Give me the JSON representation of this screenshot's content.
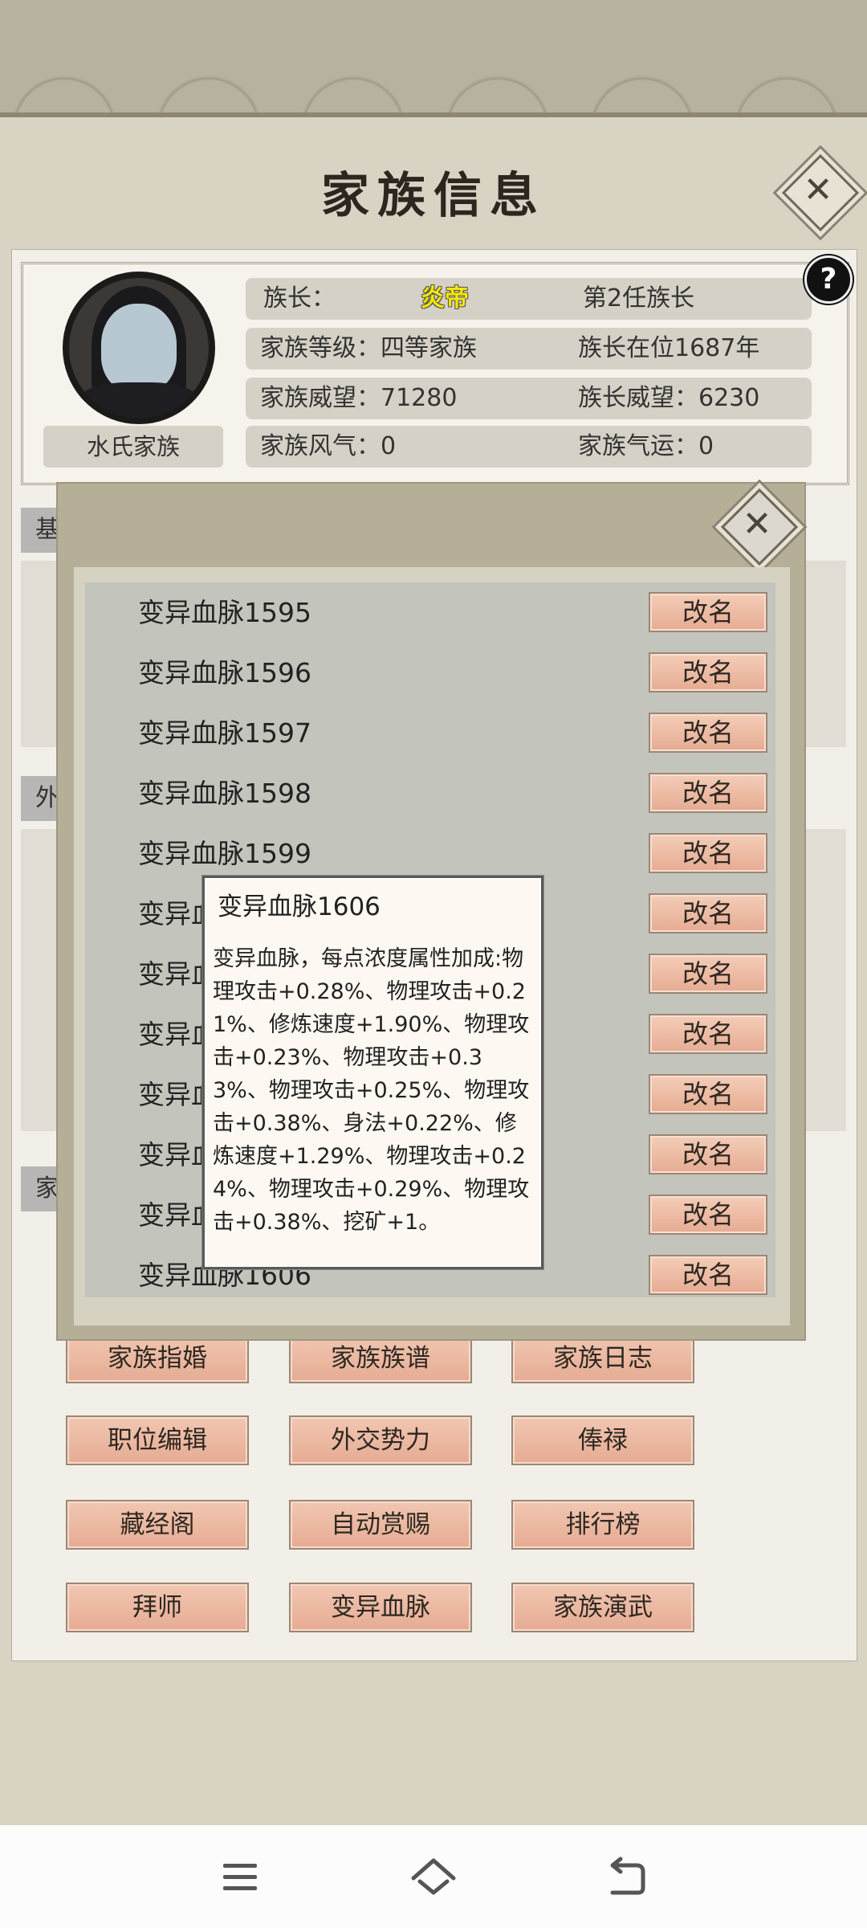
{
  "header": {
    "title": "家族信息"
  },
  "family": {
    "name": "水氏家族",
    "rows": [
      {
        "c1": "族长：",
        "c2": "炎帝",
        "c3": "第2任族长"
      },
      {
        "c1": "家族等级：四等家族",
        "c3": "族长在位1687年"
      },
      {
        "c1": "家族威望：71280",
        "c3": "族长威望：6230"
      },
      {
        "c1": "家族风气：0",
        "c3": "家族气运：0"
      }
    ],
    "help": "?"
  },
  "side_tags": [
    "基",
    "外",
    "家"
  ],
  "modal": {
    "rows": [
      {
        "label": "变异血脉1595",
        "btn": "改名"
      },
      {
        "label": "变异血脉1596",
        "btn": "改名"
      },
      {
        "label": "变异血脉1597",
        "btn": "改名"
      },
      {
        "label": "变异血脉1598",
        "btn": "改名"
      },
      {
        "label": "变异血脉1599",
        "btn": "改名"
      },
      {
        "label": "变异血",
        "btn": "改名"
      },
      {
        "label": "变异血",
        "btn": "改名"
      },
      {
        "label": "变异血",
        "btn": "改名"
      },
      {
        "label": "变异血",
        "btn": "改名"
      },
      {
        "label": "变异血",
        "btn": "改名"
      },
      {
        "label": "变异血",
        "btn": "改名"
      },
      {
        "label": "变异血脉1606",
        "btn": "改名"
      }
    ]
  },
  "tooltip": {
    "title": "变异血脉1606",
    "body": "变异血脉，每点浓度属性加成:物理攻击+0.28%、物理攻击+0.21%、修炼速度+1.90%、物理攻击+0.23%、物理攻击+0.33%、物理攻击+0.25%、物理攻击+0.38%、身法+0.22%、修炼速度+1.29%、物理攻击+0.24%、物理攻击+0.29%、物理攻击+0.38%、挖矿+1。"
  },
  "buttons": [
    "家族指婚",
    "家族族谱",
    "家族日志",
    "职位编辑",
    "外交势力",
    "俸禄",
    "藏经阁",
    "自动赏赐",
    "排行榜",
    "拜师",
    "变异血脉",
    "家族演武"
  ],
  "colors": {
    "highlight_name": "#f5e600",
    "button": "#eab69e"
  }
}
